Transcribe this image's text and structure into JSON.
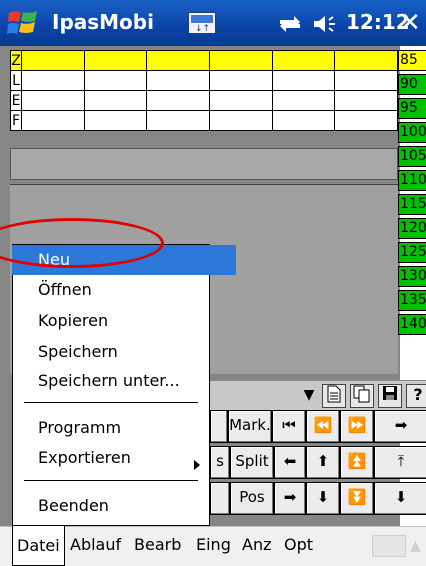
{
  "titlebar": {
    "app_title": "IpasMobi",
    "time": "12:12",
    "close": "✕",
    "start_icon": "windows-flag-icon",
    "signal_icon": "connectivity-icon",
    "volume_icon": "speaker-icon"
  },
  "grid": {
    "rows": [
      {
        "label": "Z",
        "highlight": true
      },
      {
        "label": "L",
        "highlight": false
      },
      {
        "label": "E",
        "highlight": false
      },
      {
        "label": "F",
        "highlight": false
      }
    ]
  },
  "right_column": [
    "85",
    "90",
    "95",
    "100",
    "105",
    "110",
    "115",
    "120",
    "125",
    "130",
    "135",
    "140"
  ],
  "toolbar": {
    "dropdown": "▼",
    "icons": [
      "document-icon",
      "copy-document-icon",
      "save-disk-icon",
      "help-icon"
    ],
    "help_label": "?"
  },
  "buttons": {
    "mark": "Mark.",
    "split": "Split",
    "pos": "Pos",
    "partial_s": "s"
  },
  "menu": {
    "items": [
      "Neu",
      "Öffnen",
      "Kopieren",
      "Speichern",
      "Speichern unter...",
      "Programm",
      "Exportieren",
      "Beenden"
    ],
    "selected": "Neu"
  },
  "menubar": [
    "Datei",
    "Ablauf",
    "Bearb",
    "Eing",
    "Anz",
    "Opt"
  ],
  "colors": {
    "title_bar": "#0b45a8",
    "highlight_row": "#ffff00",
    "green_cell": "#00c000",
    "menu_selection": "#2b78d8",
    "annotation": "#e00000"
  }
}
